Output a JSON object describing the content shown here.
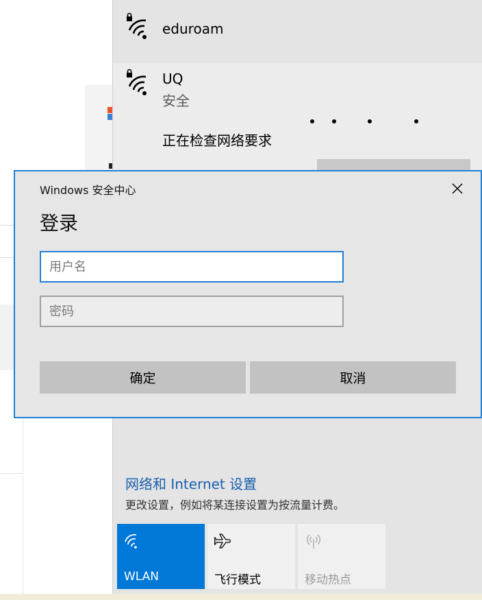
{
  "networks": [
    {
      "name": "eduroam",
      "icon": "wifi-secured-icon"
    },
    {
      "name": "UQ",
      "status": "安全",
      "progress_text": "正在检查网络要求",
      "icon": "wifi-secured-icon"
    }
  ],
  "dialog": {
    "title": "Windows 安全中心",
    "heading": "登录",
    "username_placeholder": "用户名",
    "password_placeholder": "密码",
    "ok_label": "确定",
    "cancel_label": "取消",
    "close_icon": "close-icon"
  },
  "settings": {
    "link": "网络和 Internet 设置",
    "description": "更改设置，例如将某连接设置为按流量计费。"
  },
  "quick_actions": [
    {
      "label": "WLAN",
      "icon": "wifi-icon",
      "active": true
    },
    {
      "label": "飞行模式",
      "icon": "airplane-icon",
      "active": false
    },
    {
      "label": "移动热点",
      "icon": "hotspot-icon",
      "active": false,
      "disabled": true
    }
  ],
  "colors": {
    "accent": "#0078d7",
    "link": "#1a5fae",
    "dialog_border": "#1f7fd6"
  }
}
